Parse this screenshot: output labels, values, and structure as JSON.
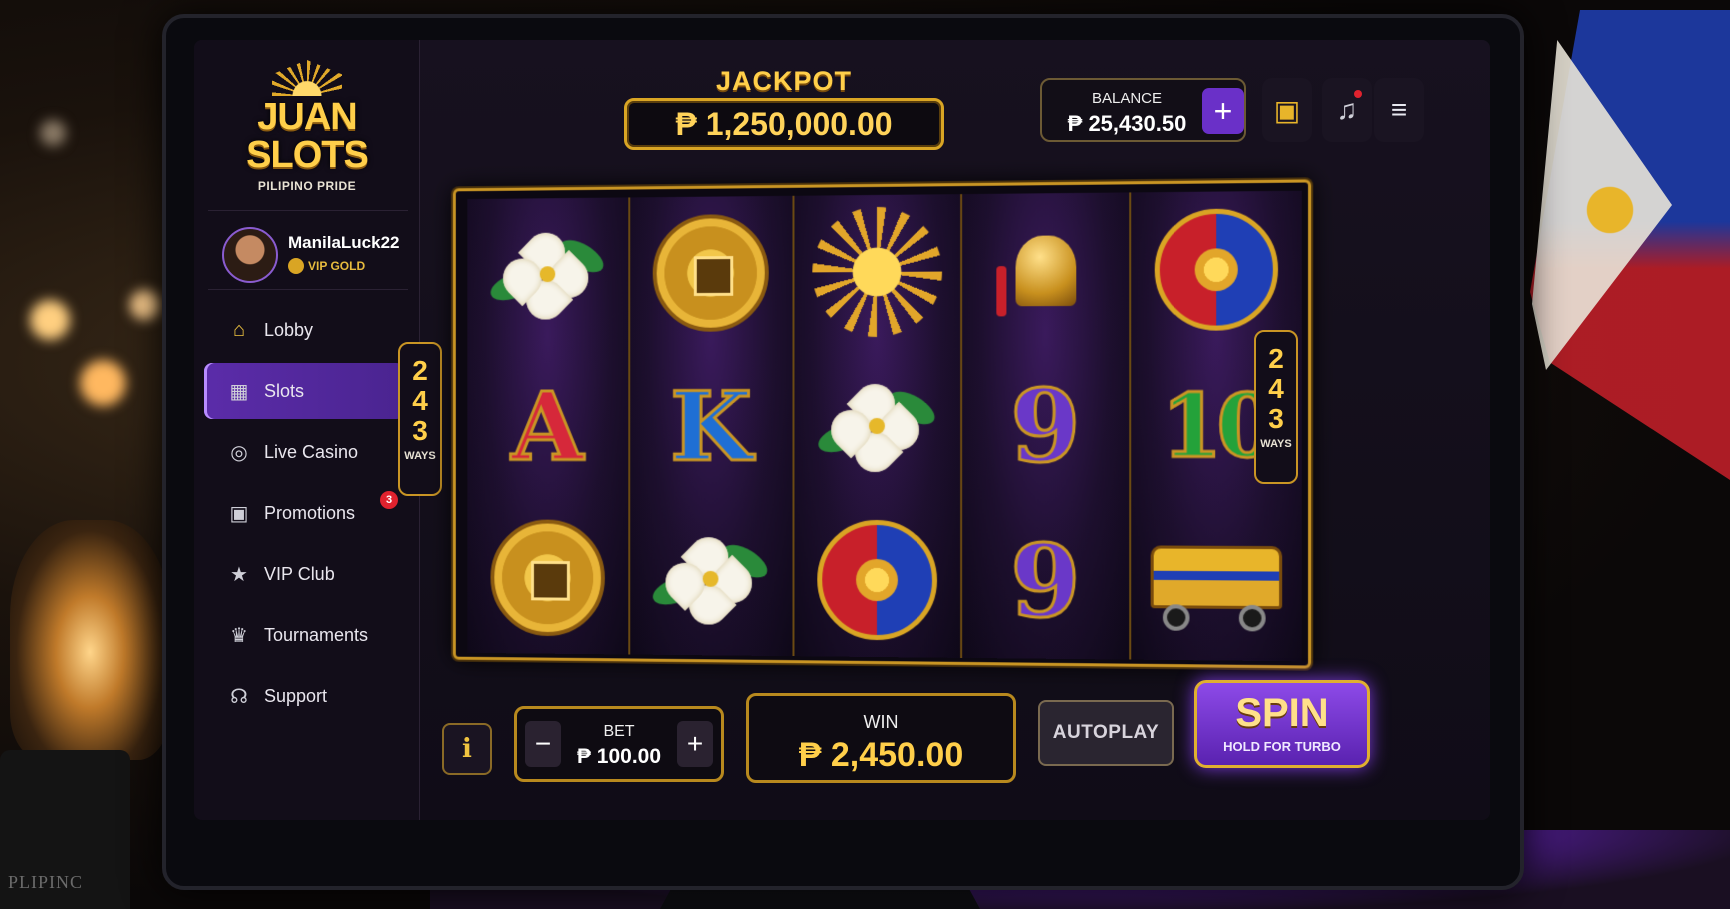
{
  "brand": {
    "logo_line1": "JUAN",
    "logo_line2": "SLOTS",
    "tagline": "PILIPINO PRIDE"
  },
  "user": {
    "name": "ManilaLuck22",
    "tier": "VIP GOLD"
  },
  "sidebar": {
    "items": [
      {
        "label": "Lobby",
        "icon": "home-icon",
        "active": false
      },
      {
        "label": "Slots",
        "icon": "slot-machine-icon",
        "active": true
      },
      {
        "label": "Live Casino",
        "icon": "poker-chip-icon",
        "active": false
      },
      {
        "label": "Promotions",
        "icon": "gift-icon",
        "active": false,
        "badge": "3"
      },
      {
        "label": "VIP Club",
        "icon": "star-icon",
        "active": false
      },
      {
        "label": "Tournaments",
        "icon": "trophy-icon",
        "active": false
      },
      {
        "label": "Support",
        "icon": "headset-icon",
        "active": false
      }
    ]
  },
  "header": {
    "jackpot_label": "JACKPOT",
    "jackpot_value": "₱ 1,250,000.00",
    "balance_label": "BALANCE",
    "balance_value": "₱ 25,430.50",
    "add_funds_symbol": "+",
    "icons": [
      "gift-icon",
      "bell-icon",
      "menu-icon"
    ]
  },
  "reels": {
    "columns": [
      [
        "sampaguita-flower",
        "A",
        "gold-coin"
      ],
      [
        "gold-coin",
        "K",
        "sampaguita-flower"
      ],
      [
        "philippine-sun",
        "sampaguita-flower",
        "sun-emblem"
      ],
      [
        "brass-bell",
        "9",
        "9"
      ],
      [
        "sun-emblem",
        "10",
        "jeepney"
      ]
    ],
    "ways_number": [
      "2",
      "4",
      "3"
    ],
    "ways_left_text": "WAYS",
    "ways_right_text": "WAYS"
  },
  "controls": {
    "info_label": "i",
    "bet_label": "BET",
    "bet_value": "₱ 100.00",
    "bet_minus": "−",
    "bet_plus": "+",
    "win_label": "WIN",
    "win_value": "₱ 2,450.00",
    "autoplay_label": "AUTOPLAY",
    "spin_label": "SPIN",
    "spin_sublabel": "HOLD FOR TURBO"
  },
  "colors": {
    "accent_purple": "#6a30c8",
    "gold": "#d9a524",
    "notification_red": "#e0222e"
  }
}
